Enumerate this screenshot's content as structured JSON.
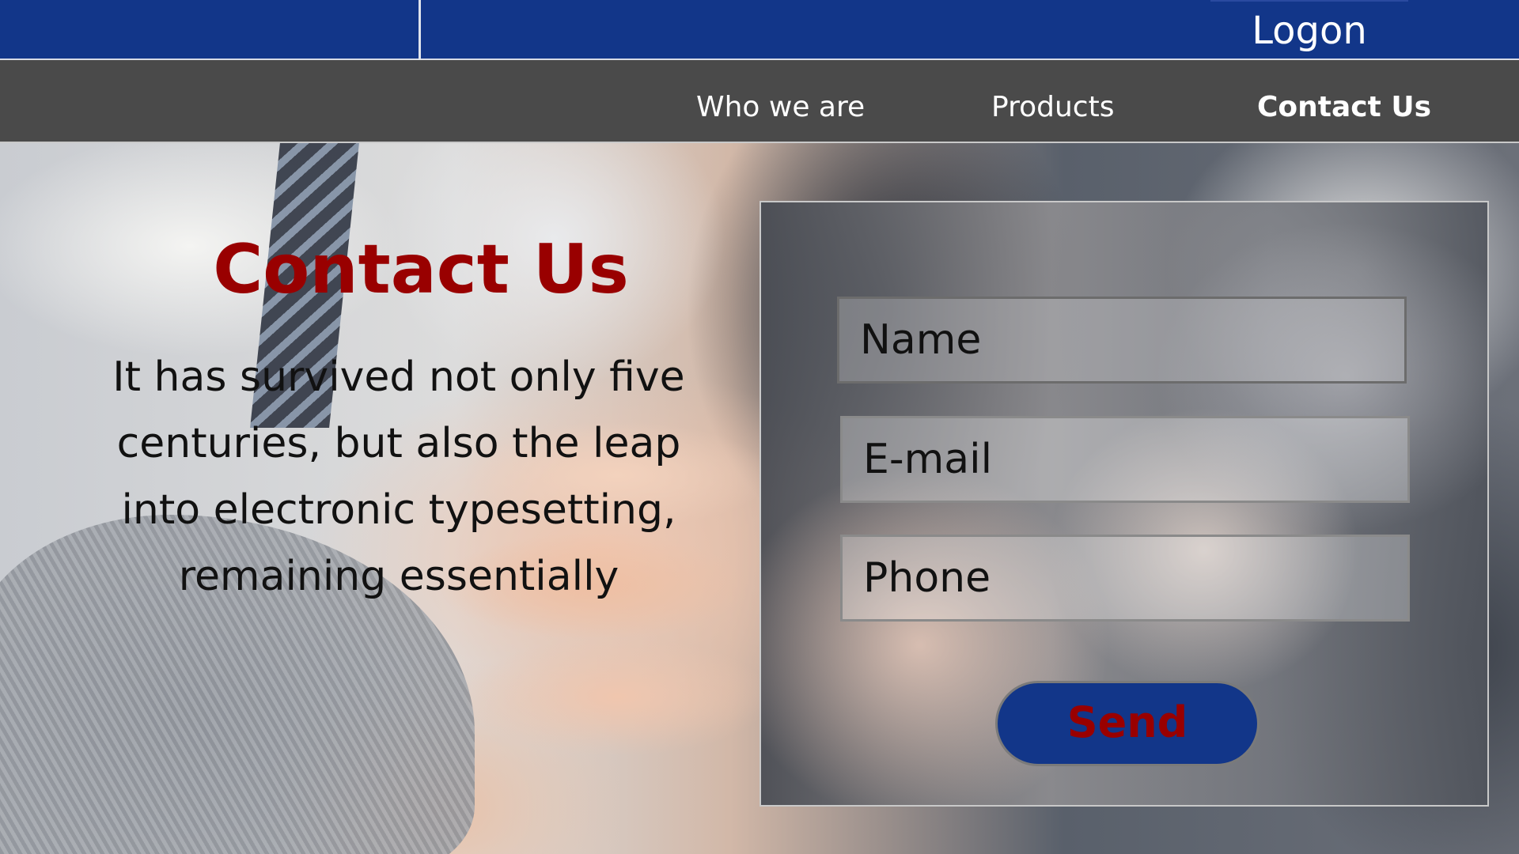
{
  "header": {
    "logon_label": "Logon"
  },
  "nav": {
    "items": [
      {
        "label": "Who we are",
        "active": false
      },
      {
        "label": "Products",
        "active": false
      },
      {
        "label": "Contact Us",
        "active": true
      }
    ]
  },
  "hero": {
    "title": "Contact Us",
    "body": "It has survived not only five centuries, but also the leap into electronic typesetting, remaining essentially"
  },
  "form": {
    "fields": [
      {
        "placeholder": "Name",
        "value": ""
      },
      {
        "placeholder": "E-mail",
        "value": ""
      },
      {
        "placeholder": "Phone",
        "value": ""
      }
    ],
    "send_label": "Send"
  },
  "colors": {
    "brand_blue": "#123689",
    "nav_gray": "#4a4a4a",
    "accent_red": "#990000"
  }
}
